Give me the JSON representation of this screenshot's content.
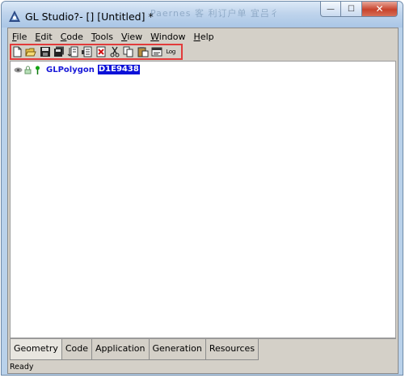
{
  "window": {
    "title": "GL Studio?-  [] [Untitled] *",
    "background_text": "Paernes  客 利订户单  宜吕彳",
    "controls": {
      "minimize": "—",
      "maximize": "☐",
      "close": "✕"
    }
  },
  "menubar": [
    {
      "mnemonic": "F",
      "rest": "ile"
    },
    {
      "mnemonic": "E",
      "rest": "dit"
    },
    {
      "mnemonic": "C",
      "rest": "ode"
    },
    {
      "mnemonic": "T",
      "rest": "ools"
    },
    {
      "mnemonic": "V",
      "rest": "iew"
    },
    {
      "mnemonic": "W",
      "rest": "indow"
    },
    {
      "mnemonic": "H",
      "rest": "elp"
    }
  ],
  "toolbar": {
    "icons": [
      "new-file-icon",
      "open-folder-icon",
      "save-icon",
      "save-all-icon",
      "import-icon",
      "export-icon",
      "delete-icon",
      "cut-icon",
      "copy-icon",
      "paste-icon",
      "properties-icon",
      "log-icon"
    ],
    "log_label": "Log",
    "highlight_color": "#e23b3b"
  },
  "tree": {
    "node_name": "GLPolygon",
    "node_id": "D1E9438",
    "node_color": "#1818d8",
    "selection_color": "#0a10d8"
  },
  "tabs": [
    "Geometry",
    "Code",
    "Application",
    "Generation",
    "Resources"
  ],
  "status": "Ready"
}
